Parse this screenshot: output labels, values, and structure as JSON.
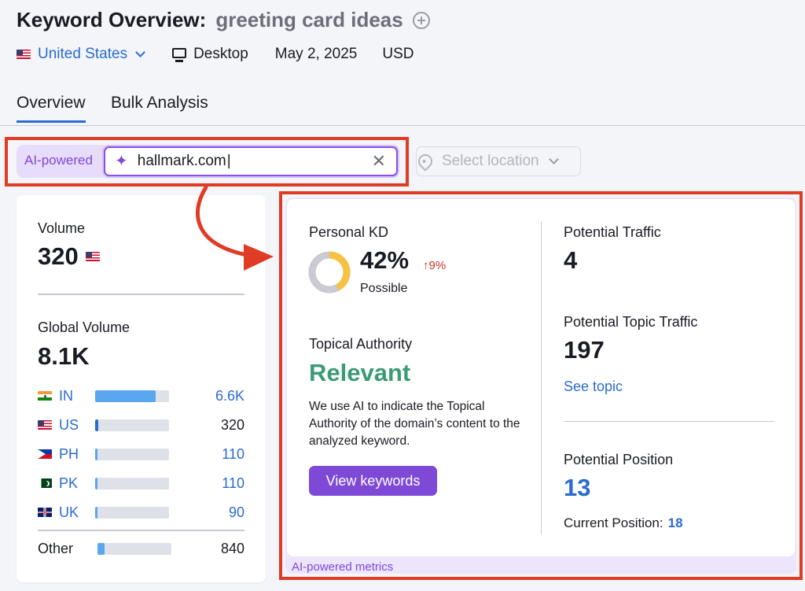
{
  "header": {
    "title": "Keyword Overview:",
    "keyword": "greeting card ideas",
    "country": "United States",
    "device": "Desktop",
    "date": "May 2, 2025",
    "currency": "USD"
  },
  "tabs": [
    {
      "label": "Overview",
      "active": true
    },
    {
      "label": "Bulk Analysis",
      "active": false
    }
  ],
  "search": {
    "ai_label": "AI-powered",
    "value": "hallmark.com",
    "location_placeholder": "Select location"
  },
  "left_card": {
    "volume_label": "Volume",
    "volume_value": "320",
    "global_volume_label": "Global Volume",
    "global_volume_value": "8.1K",
    "countries": [
      {
        "code": "IN",
        "value": "6.6K",
        "share": 0.82,
        "color": "#5aa6f0",
        "value_color": "#2a6bd1"
      },
      {
        "code": "US",
        "value": "320",
        "share": 0.04,
        "color": "#2a6bd1",
        "value_color": "#191b23"
      },
      {
        "code": "PH",
        "value": "110",
        "share": 0.03,
        "color": "#5aa6f0",
        "value_color": "#2a6bd1"
      },
      {
        "code": "PK",
        "value": "110",
        "share": 0.03,
        "color": "#5aa6f0",
        "value_color": "#2a6bd1"
      },
      {
        "code": "UK",
        "value": "90",
        "share": 0.03,
        "color": "#5aa6f0",
        "value_color": "#2a6bd1"
      }
    ],
    "other": {
      "label": "Other",
      "value": "840",
      "share": 0.1,
      "color": "#5aa6f0"
    }
  },
  "right_card": {
    "personal_kd_label": "Personal KD",
    "personal_kd_value": "42%",
    "personal_kd_change": "↑9%",
    "personal_kd_fraction": 0.42,
    "personal_kd_sub": "Possible",
    "topical_authority_label": "Topical Authority",
    "topical_authority_value": "Relevant",
    "topical_authority_desc": "We use AI to indicate the Topical Authority of the domain’s content to the analyzed keyword.",
    "view_keywords_label": "View keywords",
    "potential_traffic_label": "Potential Traffic",
    "potential_traffic_value": "4",
    "potential_topic_traffic_label": "Potential Topic Traffic",
    "potential_topic_traffic_value": "197",
    "see_topic_label": "See topic",
    "potential_position_label": "Potential Position",
    "potential_position_value": "13",
    "current_position_label": "Current Position:",
    "current_position_value": "18",
    "footer_label": "AI-powered metrics"
  },
  "colors": {
    "accent_blue": "#2a6bd1",
    "ai_purple": "#7e49d6",
    "highlight_red": "#e03b24",
    "relevant_green": "#3b9b75",
    "kd_yellow": "#f6c244"
  }
}
